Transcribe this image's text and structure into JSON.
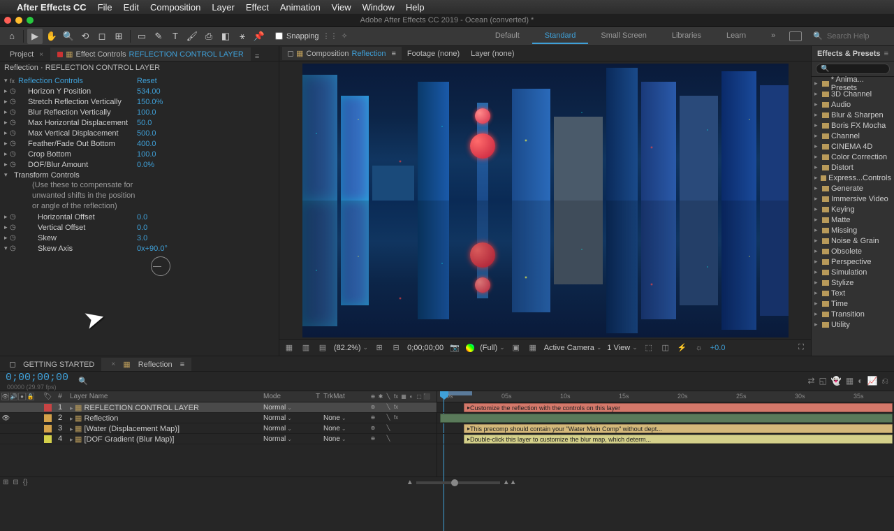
{
  "menubar": {
    "app": "After Effects CC",
    "items": [
      "File",
      "Edit",
      "Composition",
      "Layer",
      "Effect",
      "Animation",
      "View",
      "Window",
      "Help"
    ]
  },
  "title": "Adobe After Effects CC 2019 - Ocean (converted) *",
  "toolbar": {
    "snapping": "Snapping",
    "workspaces": [
      "Default",
      "Standard",
      "Small Screen",
      "Libraries",
      "Learn"
    ],
    "active_ws": "Standard",
    "search_ph": "Search Help"
  },
  "project_tab": "Project",
  "ec_tab_prefix": "Effect Controls ",
  "ec_tab_layer": "REFLECTION CONTROL LAYER",
  "ec_header": "Reflection · REFLECTION CONTROL LAYER",
  "ec": {
    "effect": "Reflection Controls",
    "reset": "Reset",
    "p": [
      {
        "n": "Horizon Y Position",
        "v": "534.00"
      },
      {
        "n": "Stretch Reflection Vertically",
        "v": "150.0%"
      },
      {
        "n": "Blur Reflection Vertically",
        "v": "100.0"
      },
      {
        "n": "Max Horizontal Displacement",
        "v": "50.0"
      },
      {
        "n": "Max Vertical Displacement",
        "v": "500.0"
      },
      {
        "n": "Feather/Fade Out Bottom",
        "v": "400.0"
      },
      {
        "n": "Crop Bottom",
        "v": "100.0"
      },
      {
        "n": "DOF/Blur Amount",
        "v": "0.0%"
      }
    ],
    "group": "Transform Controls",
    "note": [
      "(Use these to compensate for",
      "unwanted shifts in the position",
      "or angle of the reflection)"
    ],
    "p2": [
      {
        "n": "Horizontal Offset",
        "v": "0.0"
      },
      {
        "n": "Vertical Offset",
        "v": "0.0"
      },
      {
        "n": "Skew",
        "v": "3.0"
      },
      {
        "n": "Skew Axis",
        "v": "0x+90.0°"
      }
    ]
  },
  "viewer": {
    "comp_prefix": "Composition ",
    "comp": "Reflection",
    "footage": "Footage (none)",
    "layer": "Layer (none)"
  },
  "viewer_foot": {
    "zoom": "(82.2%)",
    "tc": "0;00;00;00",
    "res": "(Full)",
    "cam": "Active Camera",
    "view": "1 View",
    "exp": "+0.0"
  },
  "ep": {
    "title": "Effects & Presets",
    "items": [
      "* Anima... Presets",
      "3D Channel",
      "Audio",
      "Blur & Sharpen",
      "Boris FX Mocha",
      "Channel",
      "CINEMA 4D",
      "Color Correction",
      "Distort",
      "Express...Controls",
      "Generate",
      "Immersive Video",
      "Keying",
      "Matte",
      "Missing",
      "Noise & Grain",
      "Obsolete",
      "Perspective",
      "Simulation",
      "Stylize",
      "Text",
      "Time",
      "Transition",
      "Utility"
    ]
  },
  "tl": {
    "tabs": [
      "GETTING STARTED",
      "Reflection"
    ],
    "active_tab": "Reflection",
    "tc": "0;00;00;00",
    "tc_sub": "00000 (29.97 fps)",
    "head": {
      "num": "#",
      "name": "Layer Name",
      "mode": "Mode",
      "t": "T",
      "trk": "TrkMat"
    },
    "layers": [
      {
        "num": "1",
        "color": "red",
        "name": "REFLECTION CONTROL LAYER",
        "mode": "Normal",
        "trk": "",
        "fx": true,
        "sel": true,
        "eye": false,
        "bar": "Customize the reflection with the controls on this layer",
        "barcls": "bar-red",
        "barleft": 38
      },
      {
        "num": "2",
        "color": "ora",
        "name": "Reflection",
        "mode": "Normal",
        "trk": "None",
        "fx": true,
        "sel": false,
        "eye": true,
        "bar": "",
        "barcls": "",
        "barleft": 38
      },
      {
        "num": "3",
        "color": "ora",
        "name": "[Water (Displacement Map)]",
        "mode": "Normal",
        "trk": "None",
        "fx": false,
        "sel": false,
        "eye": false,
        "bar": "This precomp should contain your \"Water Main Comp\" without dept...",
        "barcls": "bar-ora",
        "barleft": 38
      },
      {
        "num": "4",
        "color": "yel",
        "name": "[DOF Gradient (Blur Map)]",
        "mode": "Normal",
        "trk": "None",
        "fx": false,
        "sel": false,
        "eye": false,
        "bar": "Double-click this layer to customize the blur map, which determ...",
        "barcls": "bar-yel",
        "barleft": 38
      }
    ],
    "ticks": [
      "00s",
      "05s",
      "10s",
      "15s",
      "20s",
      "25s",
      "30s",
      "35s"
    ]
  }
}
